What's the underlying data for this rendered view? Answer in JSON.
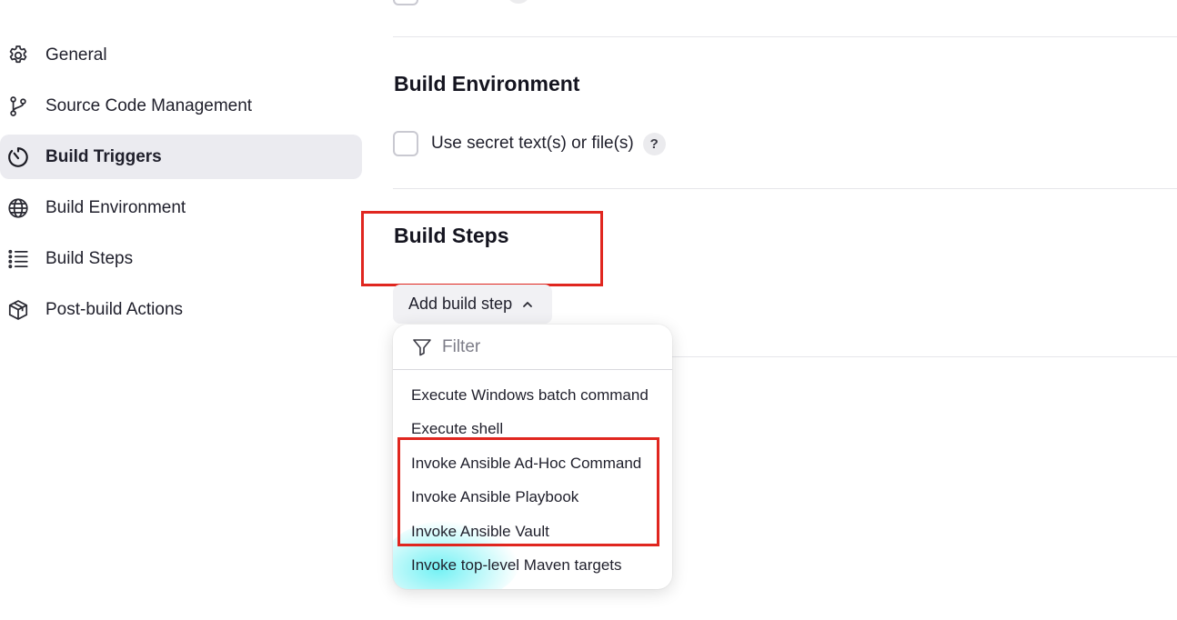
{
  "sidebar": {
    "items": [
      {
        "label": "General",
        "icon": "gear-icon",
        "active": false
      },
      {
        "label": "Source Code Management",
        "icon": "git-branch-icon",
        "active": false
      },
      {
        "label": "Build Triggers",
        "icon": "timer-icon",
        "active": true
      },
      {
        "label": "Build Environment",
        "icon": "globe-icon",
        "active": false
      },
      {
        "label": "Build Steps",
        "icon": "list-icon",
        "active": false
      },
      {
        "label": "Post-build Actions",
        "icon": "package-icon",
        "active": false
      }
    ]
  },
  "build_environment": {
    "title": "Build Environment",
    "checkbox_label": "Use secret text(s) or file(s)",
    "help": "?"
  },
  "build_steps": {
    "title": "Build Steps",
    "add_button_label": "Add build step"
  },
  "dropdown": {
    "filter_placeholder": "Filter",
    "items": [
      "Execute Windows batch command",
      "Execute shell",
      "Invoke Ansible Ad-Hoc Command",
      "Invoke Ansible Playbook",
      "Invoke Ansible Vault",
      "Invoke top-level Maven targets"
    ]
  },
  "colors": {
    "highlight": "#e0261f",
    "active_bg": "#ebebf0",
    "text": "#14141f"
  }
}
